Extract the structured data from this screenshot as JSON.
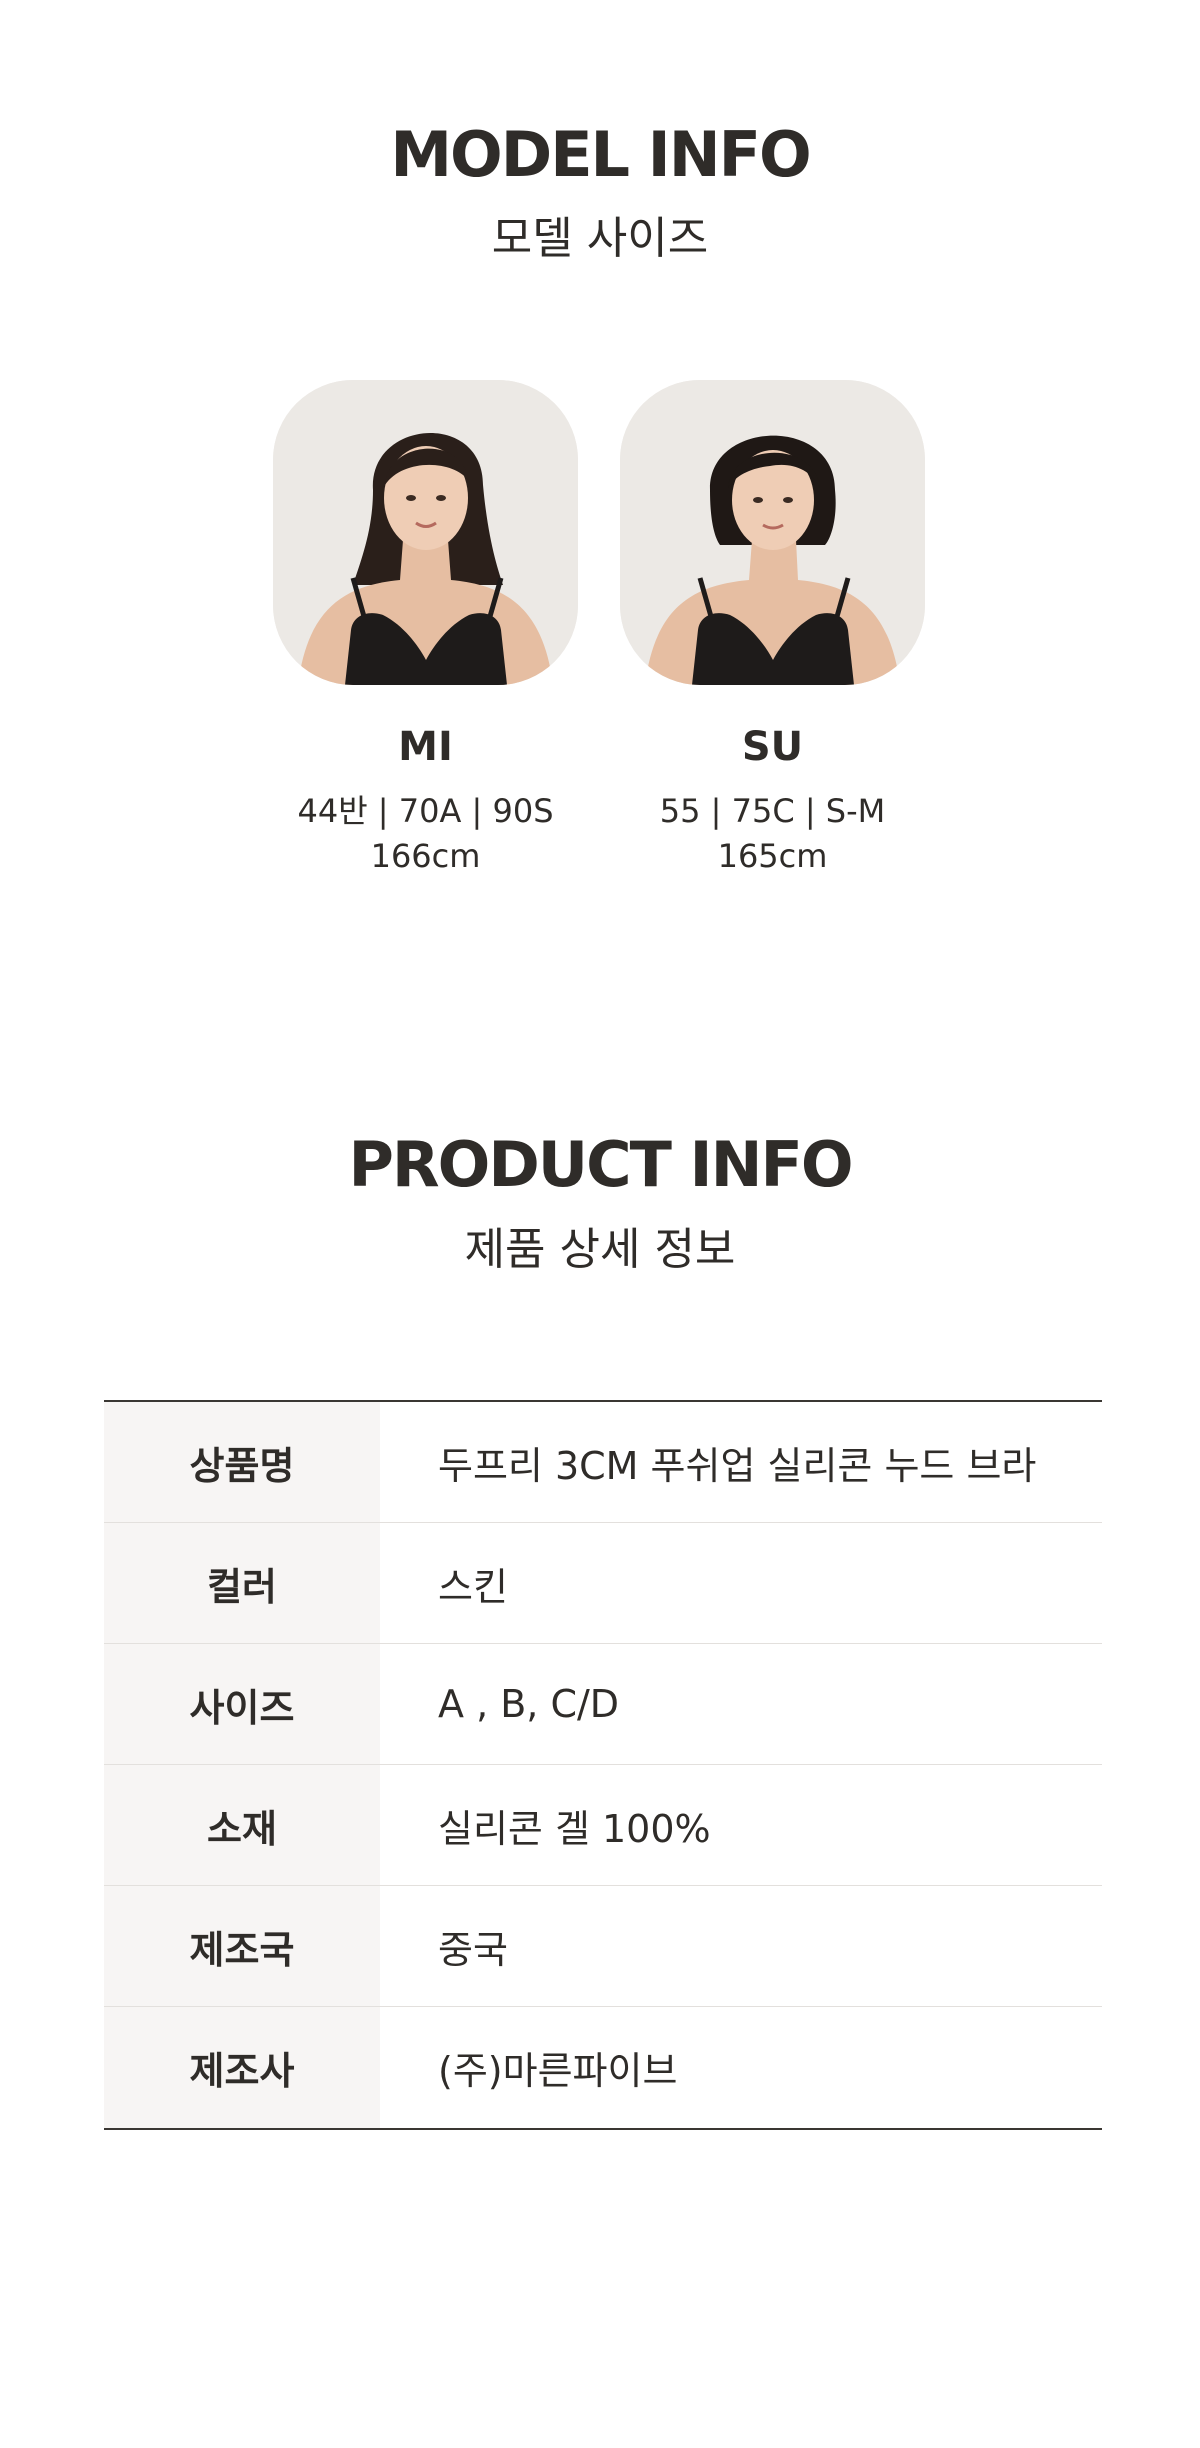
{
  "model_section": {
    "title": "MODEL INFO",
    "subtitle": "모델 사이즈",
    "models": [
      {
        "name": "MI",
        "sizes": "44반 | 70A | 90S",
        "height": "166cm"
      },
      {
        "name": "SU",
        "sizes": "55 | 75C | S-M",
        "height": "165cm"
      }
    ]
  },
  "product_section": {
    "title": "PRODUCT INFO",
    "subtitle": "제품 상세 정보",
    "rows": [
      {
        "label": "상품명",
        "value": "두프리 3CM 푸쉬업 실리콘 누드 브라"
      },
      {
        "label": "컬러",
        "value": "스킨"
      },
      {
        "label": "사이즈",
        "value": "A , B, C/D"
      },
      {
        "label": "소재",
        "value": "실리콘 겔 100%"
      },
      {
        "label": "제조국",
        "value": "중국"
      },
      {
        "label": "제조사",
        "value": "(주)마른파이브"
      }
    ]
  },
  "colors": {
    "text": "#2f2c29",
    "label_bg": "#f7f5f4",
    "photo_bg": "#ece9e5",
    "garment": "#1e1b1a",
    "skin": "#e8c3a8"
  }
}
